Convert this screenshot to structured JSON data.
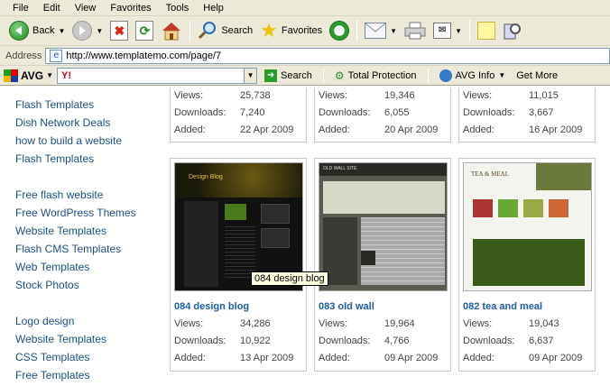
{
  "menu": [
    "File",
    "Edit",
    "View",
    "Favorites",
    "Tools",
    "Help"
  ],
  "toolbar": {
    "back": "Back",
    "search": "Search",
    "favorites": "Favorites"
  },
  "address": {
    "label": "Address",
    "url": "http://www.templatemo.com/page/7"
  },
  "avg": {
    "brand": "AVG",
    "search_provider": "Y!",
    "search_btn": "Search",
    "protection": "Total Protection",
    "info": "AVG Info",
    "more": "Get More"
  },
  "sidebar": [
    "Flash Templates",
    "Dish Network Deals",
    "how to build a website",
    "Flash Templates",
    "Free flash website",
    "Free WordPress Themes",
    "Website Templates",
    "Flash CMS Templates",
    "Web Templates",
    "Stock Photos",
    "Logo design",
    "Website Templates",
    "CSS Templates",
    "Free Templates"
  ],
  "labels": {
    "views": "Views:",
    "downloads": "Downloads:",
    "added": "Added:"
  },
  "top_cards": [
    {
      "views": "25,738",
      "downloads": "7,240",
      "added": "22 Apr 2009"
    },
    {
      "views": "19,346",
      "downloads": "6,055",
      "added": "20 Apr 2009"
    },
    {
      "views": "11,015",
      "downloads": "3,667",
      "added": "16 Apr 2009"
    }
  ],
  "cards": [
    {
      "title": "084 design blog",
      "views": "34,286",
      "downloads": "10,922",
      "added": "13 Apr 2009",
      "thumb_text": "Design Blog"
    },
    {
      "title": "083 old wall",
      "views": "19,964",
      "downloads": "4,766",
      "added": "09 Apr 2009",
      "thumb_text": "OLD WALL SITE"
    },
    {
      "title": "082 tea and meal",
      "views": "19,043",
      "downloads": "6,637",
      "added": "09 Apr 2009",
      "thumb_text": "TEA & MEAL"
    }
  ],
  "tooltip": "084 design blog"
}
